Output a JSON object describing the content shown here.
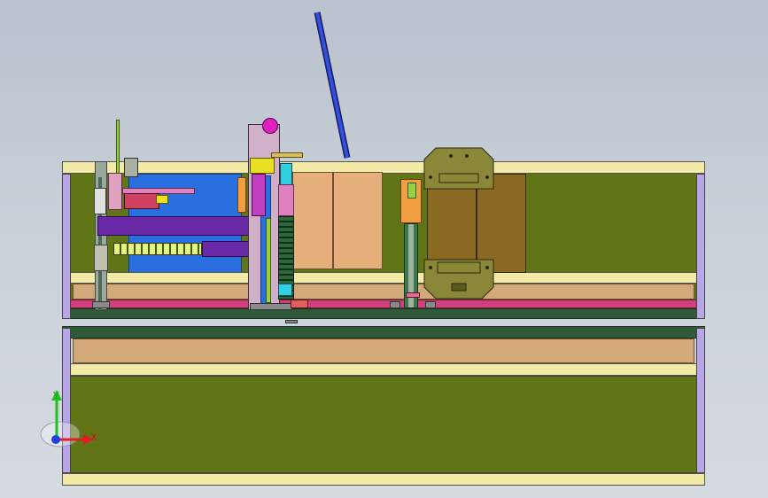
{
  "triad": {
    "x_label": "X",
    "y_label": "Y",
    "x_color": "#e02020",
    "y_color": "#20c020",
    "z_color": "#2040e0"
  },
  "icons": {
    "triad": "coordinate-triad-icon"
  }
}
